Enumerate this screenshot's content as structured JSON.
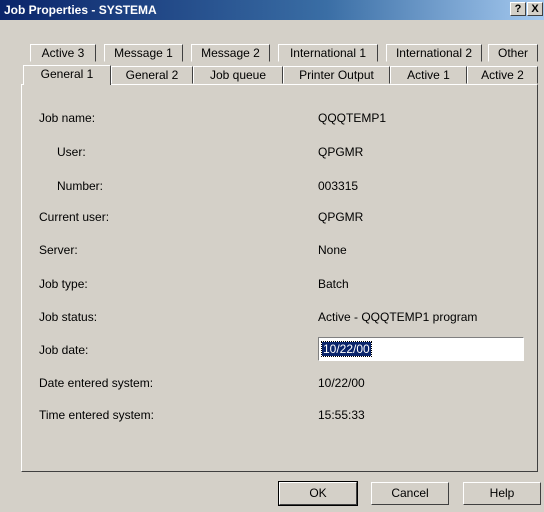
{
  "window": {
    "title": "Job Properties - SYSTEMA",
    "help_label": "?",
    "close_label": "X"
  },
  "tabs": {
    "back_row": [
      "Active 3",
      "Message 1",
      "Message 2",
      "International 1",
      "International 2",
      "Other"
    ],
    "front_row": [
      "General 1",
      "General 2",
      "Job queue",
      "Printer Output",
      "Active 1",
      "Active 2"
    ],
    "selected": "General 1"
  },
  "fields": {
    "job_name": {
      "label": "Job name:",
      "value": "QQQTEMP1"
    },
    "user": {
      "label": "User:",
      "value": "QPGMR"
    },
    "number": {
      "label": "Number:",
      "value": "003315"
    },
    "current_user": {
      "label": "Current user:",
      "value": "QPGMR"
    },
    "server": {
      "label": "Server:",
      "value": "None"
    },
    "job_type": {
      "label": "Job type:",
      "value": "Batch"
    },
    "job_status": {
      "label": "Job status:",
      "value": "Active - QQQTEMP1 program"
    },
    "job_date": {
      "label": "Job date:",
      "value": "10/22/00"
    },
    "date_entered": {
      "label": "Date entered system:",
      "value": "10/22/00"
    },
    "time_entered": {
      "label": "Time entered system:",
      "value": "15:55:33"
    }
  },
  "buttons": {
    "ok": "OK",
    "cancel": "Cancel",
    "help": "Help"
  }
}
